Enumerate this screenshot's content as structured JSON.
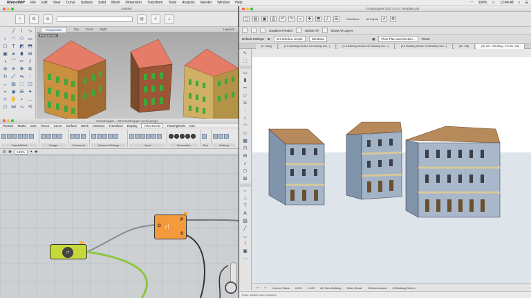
{
  "menubar": {
    "app_name": "RhinoWIP",
    "items": [
      "File",
      "Edit",
      "View",
      "Curve",
      "Surface",
      "Solid",
      "Mesh",
      "Dimension",
      "Transform",
      "Tools",
      "Analysis",
      "Render",
      "Window",
      "Help"
    ],
    "battery": "100%",
    "clock": "12:44:48"
  },
  "rhino": {
    "title": "Untitled",
    "viewport_tabs": [
      "Perspective",
      "Top",
      "Front",
      "Right"
    ],
    "layouts": "Layouts",
    "viewport_label": "Perspective"
  },
  "grasshopper": {
    "title": "Grasshopper – 3D Grasshopper Archicad.gh",
    "menu": [
      "Params",
      "Maths",
      "Sets",
      "Vector",
      "Curve",
      "Surface",
      "Mesh",
      "Intersect",
      "Transform",
      "Display",
      "ARCHICAD",
      "ParsingTools",
      "Kan"
    ],
    "ribbon_groups": [
      "Special/Built",
      "Design",
      "Document",
      "Element Settings",
      "Input",
      "Parametric",
      "Run",
      "Settings"
    ],
    "zoom": "125%",
    "node_orange": {
      "left_pin": "O",
      "pin_p": "P",
      "pin_s": "S"
    }
  },
  "archicad": {
    "title": "Grasshopper 2017-11-17 Template.pln",
    "tb1_labels": [
      "Selections",
      "All Layers"
    ],
    "tb2_labels": [
      "Gradient Presets",
      "Unlock All",
      "Show All Layers"
    ],
    "tb3": {
      "left": "Default Settings",
      "dd1": "GH Window simple",
      "dd2": "Windows",
      "right": "Floor Plan and Section...",
      "far": "Views"
    },
    "tabs": [
      "[0. Story]",
      "[4.5 Building Section 01 Building Sec...]",
      "[4.3 Building Section 02 Building Sec...]",
      "[4.5 Building Section 03 Building Sec...]",
      "[3D / All]",
      "[3D 3th – NB Bldg – PO 3D / All]"
    ],
    "status": [
      "Current Views",
      "100%",
      "1:100",
      "GH New Building",
      "Entire Model",
      "03 Architectural",
      "03 Building Sketch"
    ],
    "hint": "Enter section from of Object"
  }
}
